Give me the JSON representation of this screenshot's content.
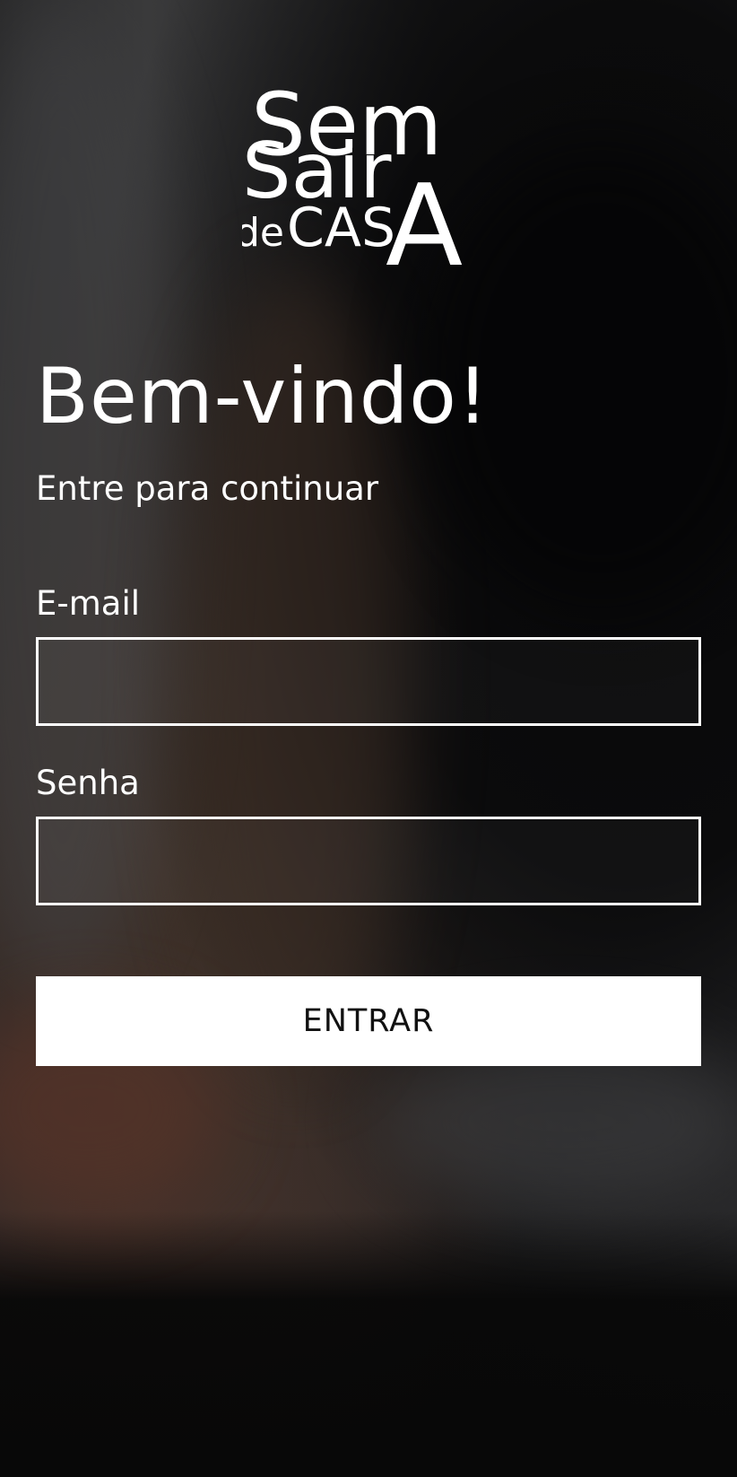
{
  "logo": {
    "line1": "Sem",
    "line2": "Sair",
    "line3_small": "de",
    "line3_caps": "CAS",
    "line3_big": "A"
  },
  "header": {
    "title": "Bem-vindo!",
    "subtitle": "Entre para continuar"
  },
  "form": {
    "email": {
      "label": "E-mail",
      "value": "",
      "placeholder": ""
    },
    "password": {
      "label": "Senha",
      "value": "",
      "placeholder": ""
    },
    "submit_label": "ENTRAR"
  },
  "colors": {
    "text": "#ffffff",
    "button_bg": "#ffffff",
    "button_text": "#111111",
    "background_dark": "#080808"
  }
}
